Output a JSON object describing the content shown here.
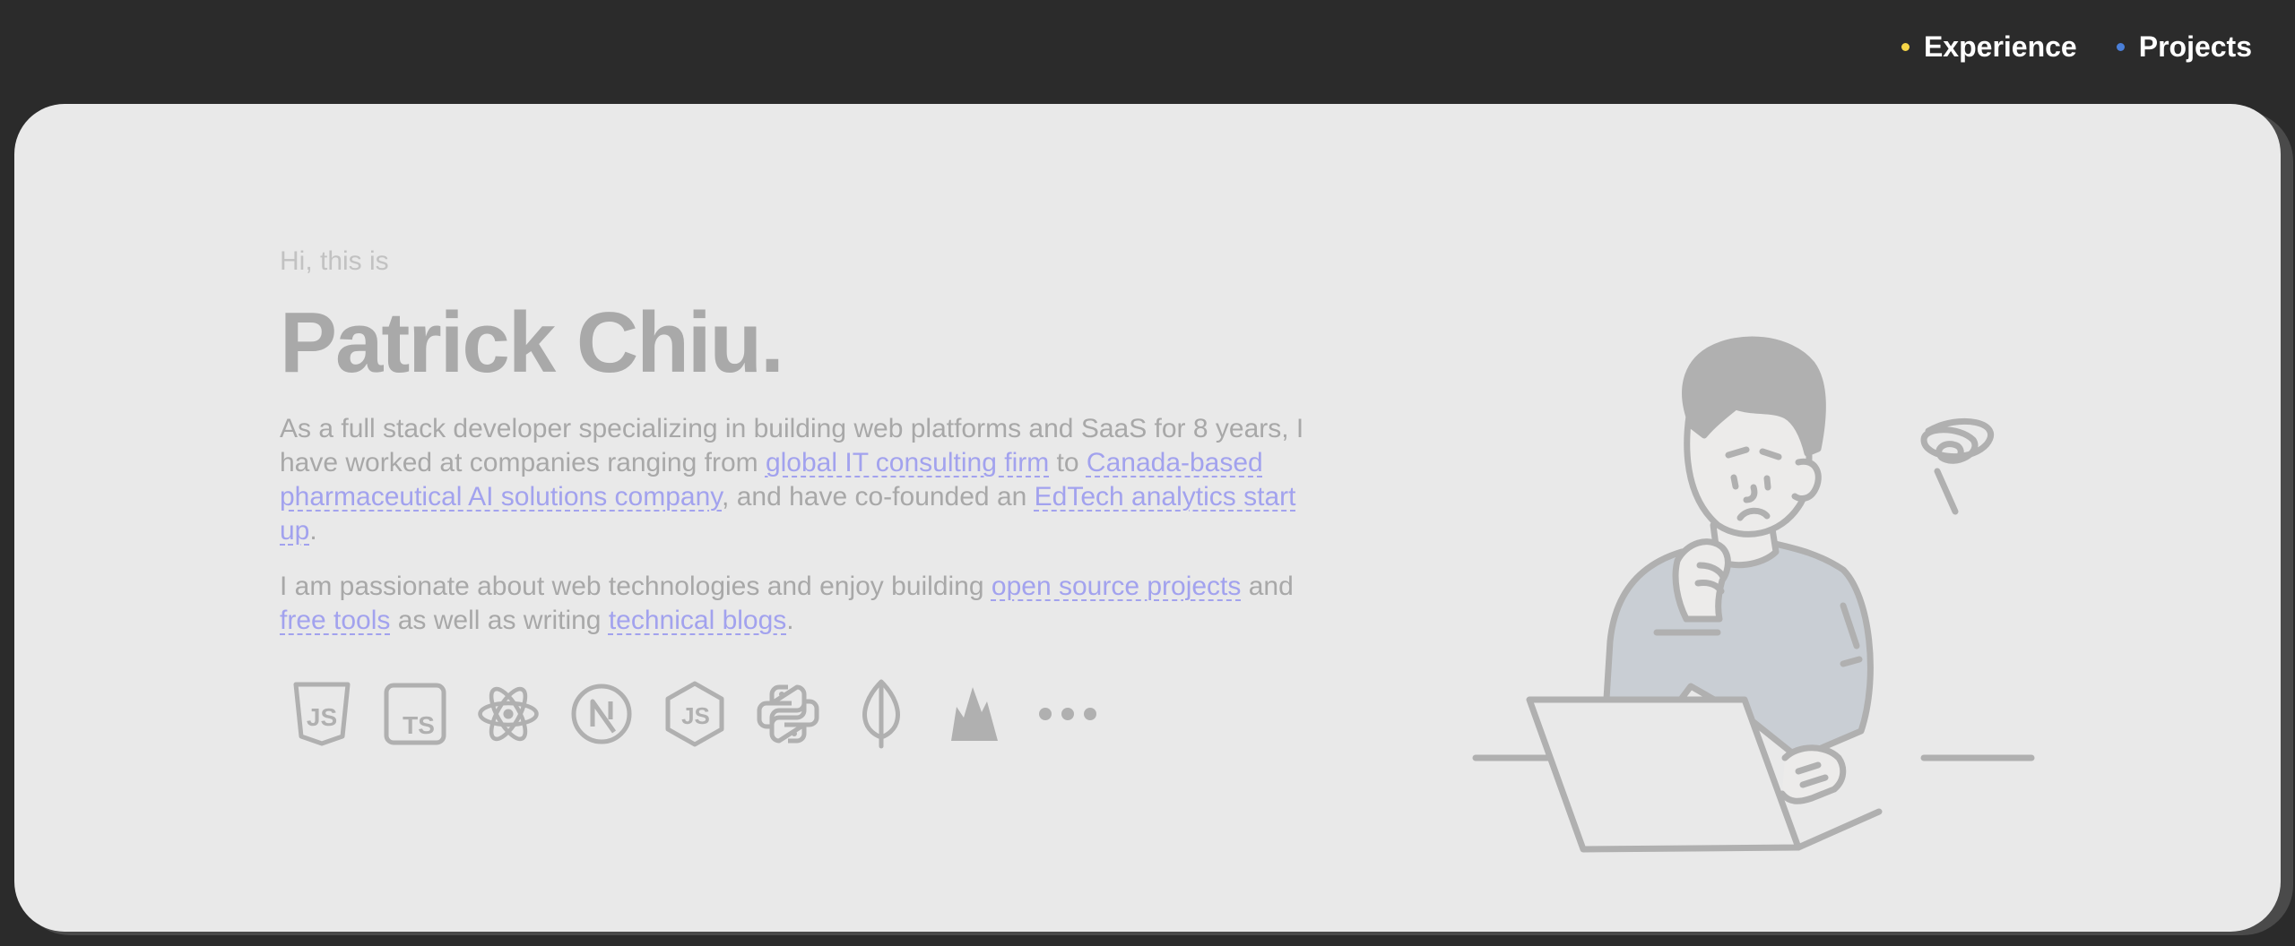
{
  "nav": {
    "items": [
      {
        "label": "Experience",
        "dot_color": "#f5d547"
      },
      {
        "label": "Projects",
        "dot_color": "#4a7fd8"
      }
    ]
  },
  "hero": {
    "greeting": "Hi, this is",
    "name": "Patrick Chiu.",
    "para1": {
      "t1": "As a full stack developer specializing in building web platforms and SaaS for 8 years, I have worked at companies ranging from ",
      "link1": "global IT consulting firm",
      "t2": " to ",
      "link2": "Canada-based pharmaceutical AI solutions company",
      "t3": ", and have co-founded an ",
      "link3": "EdTech analytics start up",
      "t4": "."
    },
    "para2": {
      "t1": "I am passionate about web technologies and enjoy building ",
      "link1": "open source projects",
      "t2": " and ",
      "link2": "free tools",
      "t3": " as well as writing ",
      "link3": "technical blogs",
      "t4": "."
    }
  },
  "tech_stack": {
    "icons": [
      "javascript-icon",
      "typescript-icon",
      "react-icon",
      "nextjs-icon",
      "nodejs-icon",
      "python-icon",
      "mongodb-icon",
      "firebase-icon",
      "more-icon"
    ],
    "js_label": "JS",
    "ts_label": "TS",
    "node_label": "JS"
  },
  "colors": {
    "page_bg": "#2b2b2b",
    "card_bg": "#e9e9e9",
    "link": "#a2a2ee",
    "muted_text": "#a8a8a8"
  }
}
